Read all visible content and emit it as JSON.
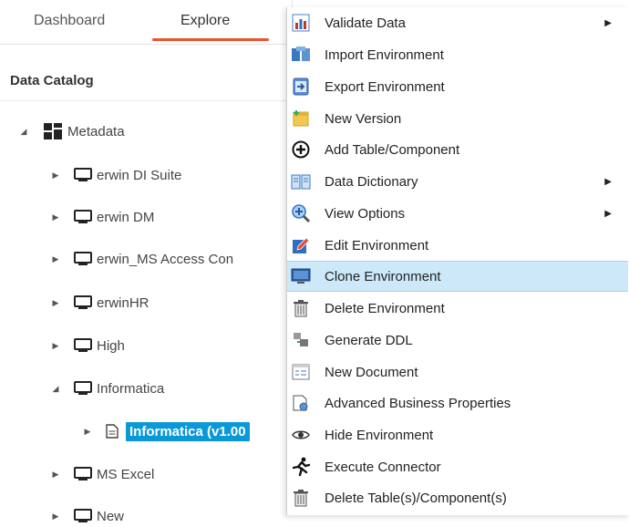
{
  "tabs": {
    "dashboard": "Dashboard",
    "explore": "Explore"
  },
  "catalog": {
    "title": "Data Catalog"
  },
  "tree": {
    "root": "Metadata",
    "items": [
      {
        "label": "erwin DI Suite"
      },
      {
        "label": "erwin DM"
      },
      {
        "label": "erwin_MS Access Con"
      },
      {
        "label": "erwinHR"
      },
      {
        "label": "High"
      },
      {
        "label": "Informatica"
      },
      {
        "label": "Informatica (v1.00"
      },
      {
        "label": "MS Excel"
      },
      {
        "label": "New"
      }
    ]
  },
  "menu": {
    "items": [
      {
        "label": "Validate Data",
        "icon": "chart-icon",
        "submenu": true
      },
      {
        "label": "Import Environment",
        "icon": "import-icon"
      },
      {
        "label": "Export Environment",
        "icon": "export-icon"
      },
      {
        "label": "New Version",
        "icon": "new-version-icon"
      },
      {
        "label": "Add Table/Component",
        "icon": "add-circle-icon"
      },
      {
        "label": "Data Dictionary",
        "icon": "book-icon",
        "submenu": true
      },
      {
        "label": "View Options",
        "icon": "zoom-icon",
        "submenu": true
      },
      {
        "label": "Edit Environment",
        "icon": "edit-icon"
      },
      {
        "label": "Clone Environment",
        "icon": "clone-icon",
        "highlighted": true
      },
      {
        "label": "Delete Environment",
        "icon": "trash-icon"
      },
      {
        "label": "Generate DDL",
        "icon": "ddl-icon"
      },
      {
        "label": "New Document",
        "icon": "document-icon"
      },
      {
        "label": "Advanced Business Properties",
        "icon": "properties-icon"
      },
      {
        "label": "Hide Environment",
        "icon": "eye-icon"
      },
      {
        "label": "Execute Connector",
        "icon": "run-icon"
      },
      {
        "label": "Delete Table(s)/Component(s)",
        "icon": "trash-icon"
      }
    ]
  },
  "colors": {
    "accent": "#e8572a",
    "selection": "#0a99d8",
    "menu_highlight": "#cde9f9"
  }
}
